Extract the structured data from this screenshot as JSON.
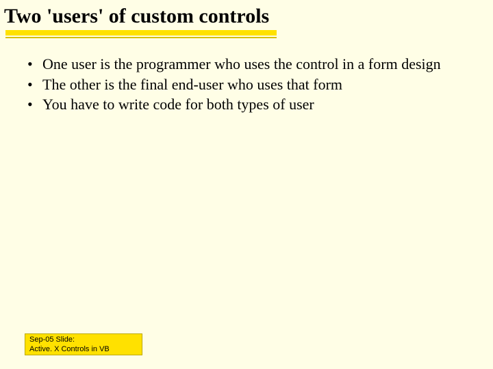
{
  "title": "Two 'users' of custom controls",
  "bullets": [
    "One user is the programmer who uses the control in a form design",
    "The other is the final end-user who uses that form",
    "You have to write code for both types of user"
  ],
  "footer": {
    "line1": "Sep-05 Slide:",
    "line2": "Active. X Controls in VB"
  }
}
